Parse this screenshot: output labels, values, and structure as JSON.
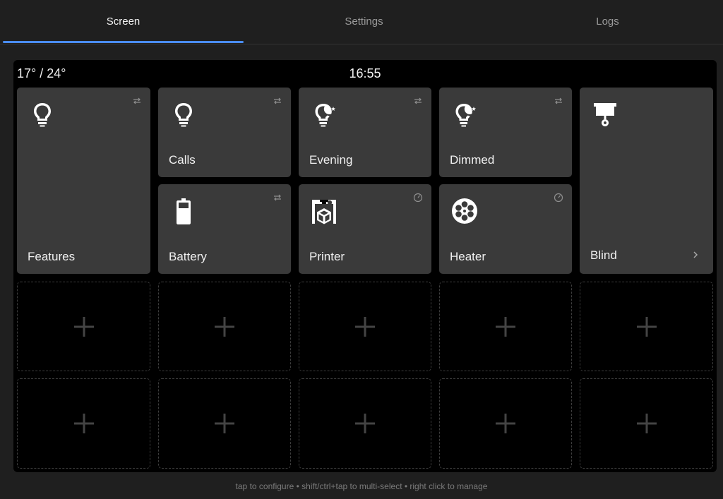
{
  "tabs": [
    {
      "label": "Screen",
      "active": true
    },
    {
      "label": "Settings",
      "active": false
    },
    {
      "label": "Logs",
      "active": false
    }
  ],
  "status_bar": {
    "temperature": "17° / 24°",
    "time": "16:55"
  },
  "tiles": [
    {
      "label": "Features",
      "icon": "lightbulb-icon",
      "badge": "swap-icon"
    },
    {
      "label": "Calls",
      "icon": "lightbulb-icon",
      "badge": "swap-icon"
    },
    {
      "label": "Evening",
      "icon": "night-bulb-icon",
      "badge": "swap-icon"
    },
    {
      "label": "Dimmed",
      "icon": "night-bulb-icon",
      "badge": "swap-icon"
    },
    {
      "label": "Blind",
      "icon": "blind-icon",
      "badge": "chevron-right-icon"
    },
    {
      "label": "Battery",
      "icon": "battery-icon",
      "badge": "swap-icon"
    },
    {
      "label": "Printer",
      "icon": "3d-printer-icon",
      "badge": "gauge-icon"
    },
    {
      "label": "Heater",
      "icon": "fan-icon",
      "badge": "gauge-icon"
    }
  ],
  "empty_slot_icon": "plus-icon",
  "footer_hint": "tap to configure • shift/ctrl+tap to multi-select • right click to manage",
  "colors": {
    "background": "#1f1f1f",
    "screen": "#000000",
    "tile": "#3a3a3a",
    "accent": "#4a8cf0",
    "dashed_border": "#3d3d3d"
  }
}
